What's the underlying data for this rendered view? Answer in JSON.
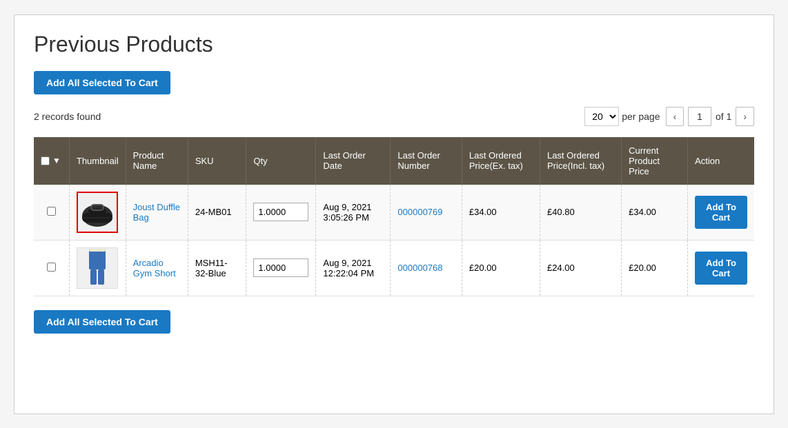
{
  "page": {
    "title": "Previous Products"
  },
  "toolbar": {
    "add_all_label": "Add All Selected To Cart",
    "records_found": "2 records found",
    "per_page": "20",
    "per_page_label": "per page",
    "current_page": "1",
    "total_pages": "of 1"
  },
  "table": {
    "headers": {
      "thumbnail": "Thumbnail",
      "product_name": "Product Name",
      "sku": "SKU",
      "qty": "Qty",
      "last_order_date": "Last Order Date",
      "last_order_number": "Last Order Number",
      "last_ordered_price_ex": "Last Ordered Price(Ex. tax)",
      "last_ordered_price_incl": "Last Ordered Price(Incl. tax)",
      "current_product_price": "Current Product Price",
      "action": "Action"
    },
    "rows": [
      {
        "id": "row1",
        "product_name": "Joust Duffle Bag",
        "product_link": "#",
        "sku": "24-MB01",
        "qty": "1.0000",
        "last_order_date": "Aug 9, 2021 3:05:26 PM",
        "last_order_number": "000000769",
        "last_order_link": "#",
        "last_price_ex": "£34.00",
        "last_price_incl": "£40.80",
        "current_price": "£34.00",
        "add_to_cart_label": "Add To Cart",
        "thumbnail_type": "bag"
      },
      {
        "id": "row2",
        "product_name": "Arcadio Gym Short",
        "product_link": "#",
        "sku": "MSH11-32-Blue",
        "qty": "1.0000",
        "last_order_date": "Aug 9, 2021 12:22:04 PM",
        "last_order_number": "000000768",
        "last_order_link": "#",
        "last_price_ex": "£20.00",
        "last_price_incl": "£24.00",
        "current_price": "£20.00",
        "add_to_cart_label": "Add To Cart",
        "thumbnail_type": "shorts"
      }
    ]
  },
  "bottom": {
    "add_all_label": "Add All Selected To Cart"
  }
}
